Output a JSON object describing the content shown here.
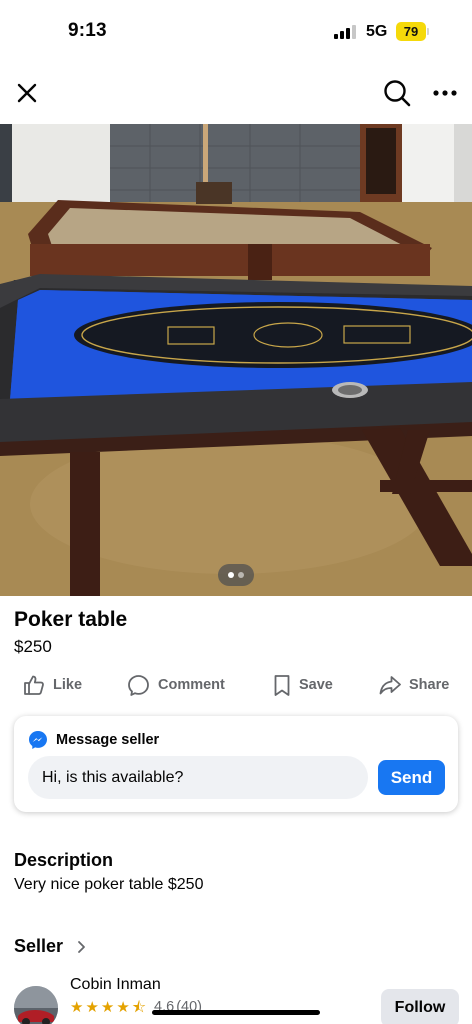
{
  "status_bar": {
    "time": "9:13",
    "network": "5G",
    "battery": "79",
    "battery_color": "#f5d90a"
  },
  "nav": {
    "close_icon": "close-icon",
    "search_icon": "search-icon",
    "more_icon": "more-horizontal-icon"
  },
  "photo": {
    "description_icon": "listing-photo",
    "page_count": 2,
    "current_page": 1
  },
  "listing": {
    "title": "Poker table",
    "price": "$250"
  },
  "actions": {
    "like": "Like",
    "comment": "Comment",
    "save": "Save",
    "share": "Share"
  },
  "message": {
    "heading": "Message seller",
    "input_value": "Hi, is this available?",
    "send_label": "Send",
    "accent": "#1877f2"
  },
  "description": {
    "heading": "Description",
    "text": "Very nice poker table $250"
  },
  "seller": {
    "heading": "Seller",
    "name": "Cobin Inman",
    "rating": "4.6",
    "rating_count": "(40)",
    "stars": 4.5,
    "follow_label": "Follow"
  },
  "colors": {
    "secondary_text": "#65676b",
    "star": "#e4a200"
  }
}
